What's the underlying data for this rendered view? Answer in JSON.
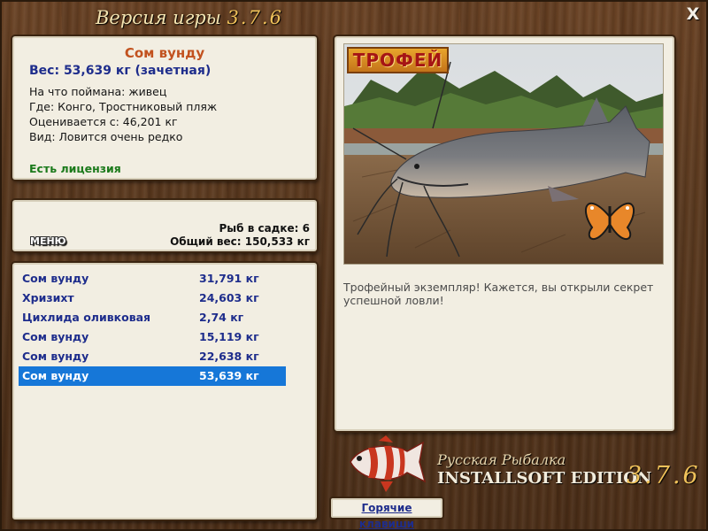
{
  "header": {
    "title_prefix": "Версия игры",
    "title_version": "3.7.6",
    "close_label": "X"
  },
  "info": {
    "fish_name": "Сом вунду",
    "weight": "Вес: 53,639 кг (зачетная)",
    "bait": "На что поймана: живец",
    "location": "Где: Конго, Тростниковый пляж",
    "valued_from": "Оценивается с: 46,201 кг",
    "kind": "Вид: Ловится очень редко",
    "license": "Есть лицензия"
  },
  "stats": {
    "menu_label": "МЕНЮ",
    "fish_in_net": "Рыб в садке: 6",
    "total_weight": "Общий вес: 150,533 кг"
  },
  "catch_list": [
    {
      "name": "Сом вунду",
      "weight": "31,791 кг",
      "selected": false
    },
    {
      "name": "Хризихт",
      "weight": "24,603 кг",
      "selected": false
    },
    {
      "name": "Цихлида оливковая",
      "weight": "2,74 кг",
      "selected": false
    },
    {
      "name": "Сом вунду",
      "weight": "15,119 кг",
      "selected": false
    },
    {
      "name": "Сом вунду",
      "weight": "22,638 кг",
      "selected": false
    },
    {
      "name": "Сом вунду",
      "weight": "53,639 кг",
      "selected": true
    }
  ],
  "photo": {
    "badge": "ТРОФЕЙ",
    "caption": "Трофейный экземпляр! Кажется, вы открыли секрет успешной ловли!"
  },
  "logo": {
    "line1": "Русская Рыбалка",
    "line2": "INSTALLSOFT EDITION",
    "version": "3.7.6"
  },
  "hotkeys_label": "Горячие клавиши",
  "colors": {
    "fish_name": "#c2521f",
    "weight": "#1e2d8c",
    "license": "#1b7a1b",
    "selected_row": "#1677d8",
    "panel_bg": "#f2eee2"
  }
}
